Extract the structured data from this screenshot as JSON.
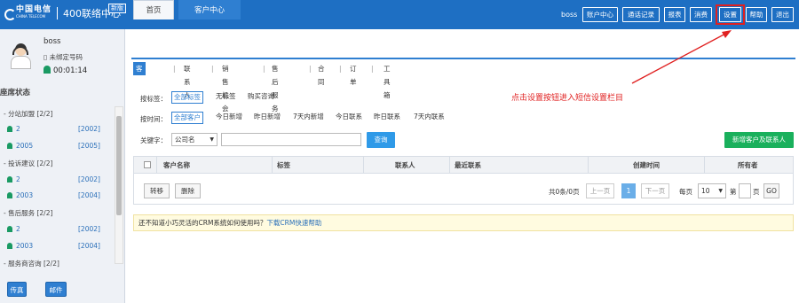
{
  "header": {
    "logo_cn": "中国电信",
    "logo_en": "CHINA TELECOM",
    "app_title": "400联络中心",
    "version_badge": "新版",
    "username": "boss",
    "buttons": [
      "账户中心",
      "通话记录",
      "报表",
      "消费",
      "设置",
      "帮助",
      "退出"
    ]
  },
  "sidebar": {
    "name": "boss",
    "phone_status": "未绑定号码",
    "timer": "00:01:14",
    "status_title": "座席状态",
    "groups": [
      {
        "label": "- 分站加盟 [2/2]",
        "items": [
          {
            "name": "2",
            "code": "[2002]"
          },
          {
            "name": "2005",
            "code": "[2005]"
          }
        ]
      },
      {
        "label": "- 投诉建议 [2/2]",
        "items": [
          {
            "name": "2",
            "code": "[2002]"
          },
          {
            "name": "2003",
            "code": "[2004]"
          }
        ]
      },
      {
        "label": "- 售后服务 [2/2]",
        "items": [
          {
            "name": "2",
            "code": "[2002]"
          },
          {
            "name": "2003",
            "code": "[2004]"
          }
        ]
      },
      {
        "label": "- 服务商咨询 [2/2]",
        "items": []
      }
    ],
    "btn_fax": "传真",
    "btn_mail": "邮件"
  },
  "tabs": [
    "首页",
    "客户中心"
  ],
  "subnav": [
    "客户管理",
    "联系人",
    "销售机会",
    "售后服务",
    "合同",
    "订单",
    "工具箱"
  ],
  "filters": {
    "tag_label": "按标签：",
    "tag_options": [
      "全部标签",
      "无标签",
      "购买咨询"
    ],
    "time_label": "按时间：",
    "time_options": [
      "全部客户",
      "今日新增",
      "昨日新增",
      "7天内新增",
      "今日联系",
      "昨日联系",
      "7天内联系"
    ],
    "keyword_label": "关键字：",
    "keyword_field": "公司名",
    "search_btn": "查询",
    "add_btn": "新增客户及联系人"
  },
  "annotation": "点击设置按钮进入短信设置栏目",
  "table": {
    "columns": [
      "客户名称",
      "标签",
      "联系人",
      "最近联系",
      "创建时间",
      "所有者"
    ],
    "btn_transfer": "转移",
    "btn_delete": "删除",
    "summary": "共0条/0页",
    "prev": "上一页",
    "page": "1",
    "next": "下一页",
    "per_page_label": "每页",
    "per_page": "10",
    "goto_label": "第",
    "goto_suffix": "页",
    "go": "GO"
  },
  "help_text": "还不知道小巧灵活的CRM系统如何使用吗？",
  "help_link": "下载CRM快速帮助"
}
